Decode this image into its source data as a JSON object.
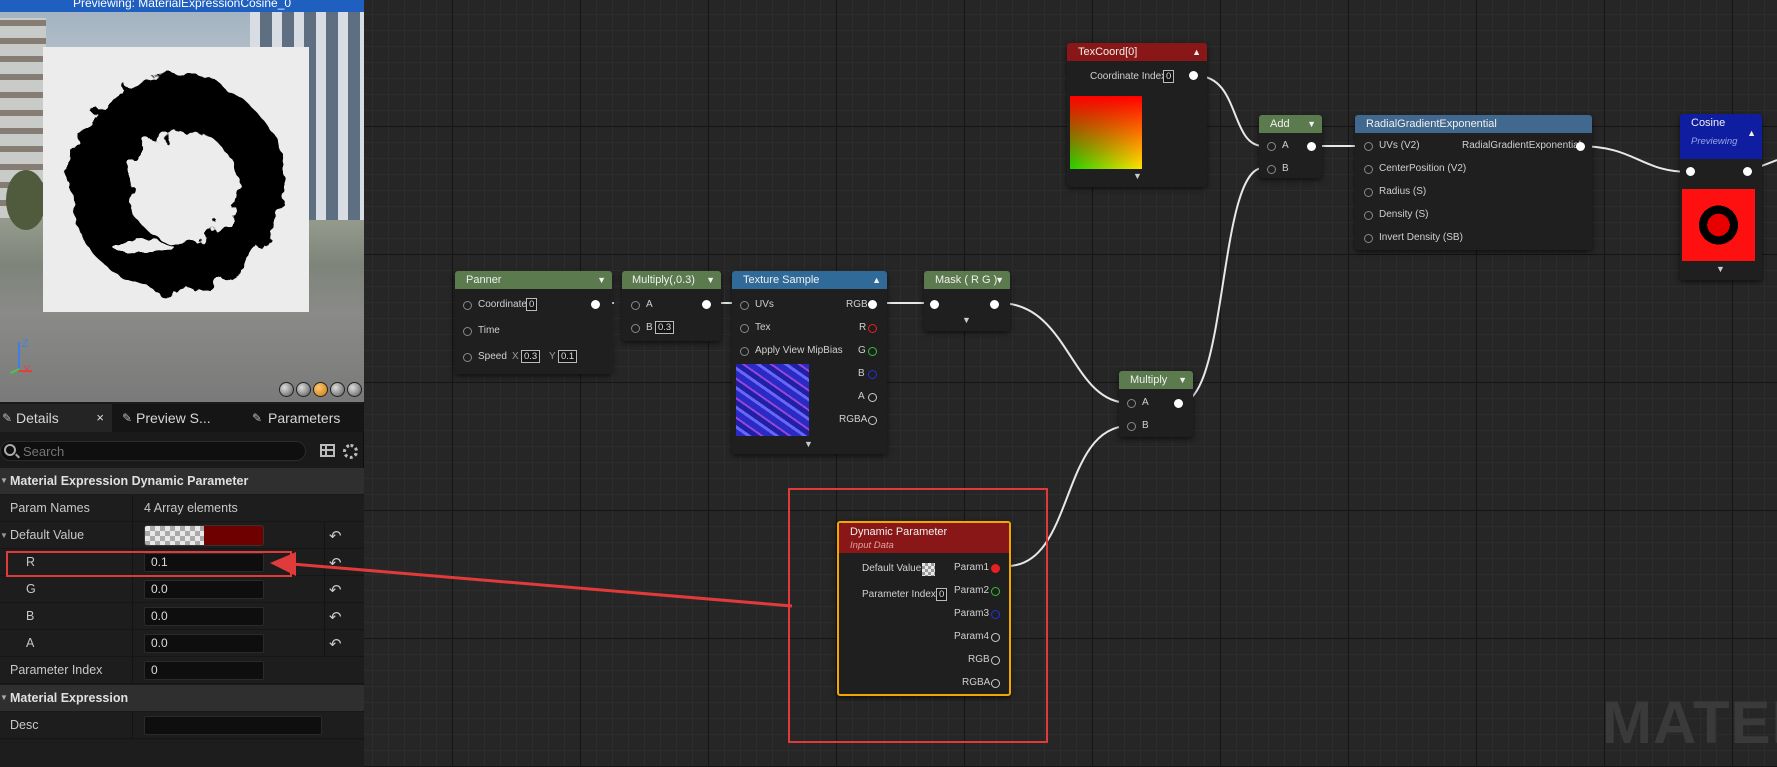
{
  "preview": {
    "title": "Previewing: MaterialExpressionCosine_0",
    "axis": {
      "z": "Z",
      "x": "X"
    }
  },
  "tabs": [
    {
      "label": "Details",
      "close": "×"
    },
    {
      "label": "Preview S..."
    },
    {
      "label": "Parameters"
    }
  ],
  "search": {
    "placeholder": "Search"
  },
  "details": {
    "section1": "Material Expression Dynamic Parameter",
    "param_names_label": "Param Names",
    "param_names_value": "4 Array elements",
    "default_value_label": "Default Value",
    "rows": [
      {
        "label": "R",
        "value": "0.1"
      },
      {
        "label": "G",
        "value": "0.0"
      },
      {
        "label": "B",
        "value": "0.0"
      },
      {
        "label": "A",
        "value": "0.0"
      }
    ],
    "parameter_index_label": "Parameter Index",
    "parameter_index_value": "0",
    "section2": "Material Expression",
    "desc_label": "Desc",
    "desc_value": ""
  },
  "nodes": {
    "panner": {
      "title": "Panner",
      "coordinate": "Coordinate",
      "coordinate_index": "0",
      "time": "Time",
      "speed": "Speed",
      "x_label": "X",
      "x_value": "0.3",
      "y_label": "Y",
      "y_value": "0.1"
    },
    "multiply03": {
      "title": "Multiply(,0.3)",
      "a": "A",
      "b": "B",
      "b_value": "0.3"
    },
    "texture_sample": {
      "title": "Texture Sample",
      "uvs": "UVs",
      "tex": "Tex",
      "mip": "Apply View MipBias",
      "rgb": "RGB",
      "r": "R",
      "g": "G",
      "b": "B",
      "a": "A",
      "rgba": "RGBA"
    },
    "mask": {
      "title": "Mask ( R G )"
    },
    "texcoord": {
      "title": "TexCoord[0]",
      "coordinate_index": "Coordinate Index",
      "coordinate_index_value": "0"
    },
    "add": {
      "title": "Add",
      "a": "A",
      "b": "B"
    },
    "radial": {
      "title": "RadialGradientExponential",
      "uvs": "UVs (V2)",
      "output": "RadialGradientExponential",
      "center": "CenterPosition (V2)",
      "radius": "Radius (S)",
      "density": "Density (S)",
      "invert": "Invert Density (SB)"
    },
    "cosine": {
      "title": "Cosine",
      "subtitle": "Previewing"
    },
    "multiply": {
      "title": "Multiply",
      "a": "A",
      "b": "B"
    },
    "dynamic": {
      "title": "Dynamic Parameter",
      "subtitle": "Input Data",
      "default_value": "Default Value",
      "parameter_index": "Parameter Index",
      "parameter_index_value": "0",
      "outputs": [
        "Param1",
        "Param2",
        "Param3",
        "Param4",
        "RGB",
        "RGBA"
      ]
    }
  },
  "watermark": "MATER",
  "colors": {
    "dynamic_header": "#8a1717",
    "green_header": "#5b7a4e",
    "annotation": "#e03a3a",
    "selection": "#f2a700"
  },
  "icons": [
    "search-icon",
    "grid-view-icon",
    "settings-gear-icon",
    "reset-arrow-icon",
    "close-icon",
    "collapse-chevron-icon",
    "pencil-icon"
  ]
}
